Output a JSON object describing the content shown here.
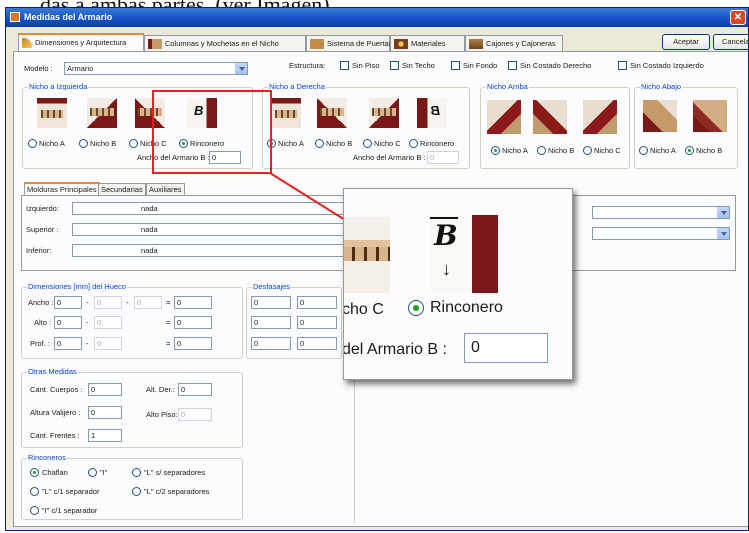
{
  "doc_fragment": "das a ambas partes, (ver Imagen).",
  "window": {
    "title": "Medidas del Armario",
    "close_glyph": "✕"
  },
  "tabs": [
    {
      "label": "Dimensiones y Arquitectura",
      "active": true
    },
    {
      "label": "Columnas y Mochetas en el Nicho"
    },
    {
      "label": "Sistema de Puertas"
    },
    {
      "label": "Materiales"
    },
    {
      "label": "Cajones y Cajoneras"
    }
  ],
  "buttons": {
    "accept": "Aceptar",
    "cancel": "Cancelar"
  },
  "model": {
    "label": "Modelo :",
    "value": "Armario"
  },
  "structure": {
    "label": "Estructura:",
    "options": [
      {
        "label": "Sin Piso",
        "checked": false
      },
      {
        "label": "Sin Techo",
        "checked": false
      },
      {
        "label": "Sin Fondo",
        "checked": false
      },
      {
        "label": "Sin Costado Derecho",
        "checked": false
      },
      {
        "label": "Sin Costado Izquierdo",
        "checked": false
      }
    ]
  },
  "nicho_izquierda": {
    "title": "Nicho a Izquierda",
    "options": [
      "Nicho A",
      "Nicho B",
      "Nicho C",
      "Rinconero"
    ],
    "selected": "Rinconero",
    "width_label": "Ancho del Armario B :",
    "width_value": "0"
  },
  "nicho_derecha": {
    "title": "Nicho a Derecha",
    "options": [
      "Nicho A",
      "Nicho B",
      "Nicho C",
      "Rinconero"
    ],
    "selected": "Nicho A",
    "width_label": "Ancho del Armario B :",
    "width_value": "0"
  },
  "nicho_arriba": {
    "title": "Nicho Arriba",
    "options": [
      "Nicho A",
      "Nicho B",
      "Nicho C"
    ],
    "selected": "Nicho A"
  },
  "nicho_abajo": {
    "title": "Nicho Abajo",
    "options": [
      "Nicho A",
      "Nicho B"
    ],
    "selected": "Nicho B"
  },
  "moldings": {
    "tabs": [
      "Molduras Principales",
      "Secundarias",
      "Auxiliares"
    ],
    "rows": [
      {
        "label": "Izquierdo:",
        "value": "nada"
      },
      {
        "label": "Superior :",
        "value": "nada"
      },
      {
        "label": "Inferior:",
        "value": "nada"
      }
    ]
  },
  "hueco": {
    "title": "Dimensiones [mm] del Hueco",
    "rows": [
      {
        "label": "Ancho :",
        "a": "0",
        "b": "0",
        "c": "0",
        "result": "0",
        "ops": [
          "-",
          "-",
          "="
        ]
      },
      {
        "label": "Alto :",
        "a": "0",
        "b": "0",
        "result": "0",
        "ops": [
          "-",
          "="
        ]
      },
      {
        "label": "Prof. :",
        "a": "0",
        "b": "0",
        "result": "0",
        "ops": [
          "-",
          "="
        ]
      }
    ]
  },
  "desfasajes": {
    "title": "Desfasajes",
    "values": [
      [
        "0",
        "0"
      ],
      [
        "0",
        "0"
      ],
      [
        "0",
        "0"
      ]
    ]
  },
  "otras": {
    "title": "Otras Medidas",
    "cuerpos_label": "Cant. Cuerpos :",
    "cuerpos_value": "0",
    "alt_der_label": "Alt. Der.:",
    "alt_der_value": "0",
    "altura_label": "Altura Valijero :",
    "altura_value": "0",
    "alto_piso_label": "Alto Piso:",
    "alto_piso_value": "0",
    "frentes_label": "Cant. Frentes :",
    "frentes_value": "1"
  },
  "rinconeros": {
    "title": "Rinconeros",
    "options": [
      "Chaflan",
      "\"I\"",
      "\"L\" s/ separadores",
      "\"L\" c/1 separador",
      "\"L\" c/2 separadores",
      "\"I\" c/1 separador"
    ],
    "selected": "Chaflan"
  },
  "zoom": {
    "option_partial": "cho C",
    "option_selected": "Rinconero",
    "width_label": "del Armario B :",
    "width_value": "0"
  },
  "colors": {
    "highlight": "#e32222",
    "title_bar": "#1553c4",
    "tab_accent": "#e68b2c",
    "group_title": "#0046d5"
  }
}
